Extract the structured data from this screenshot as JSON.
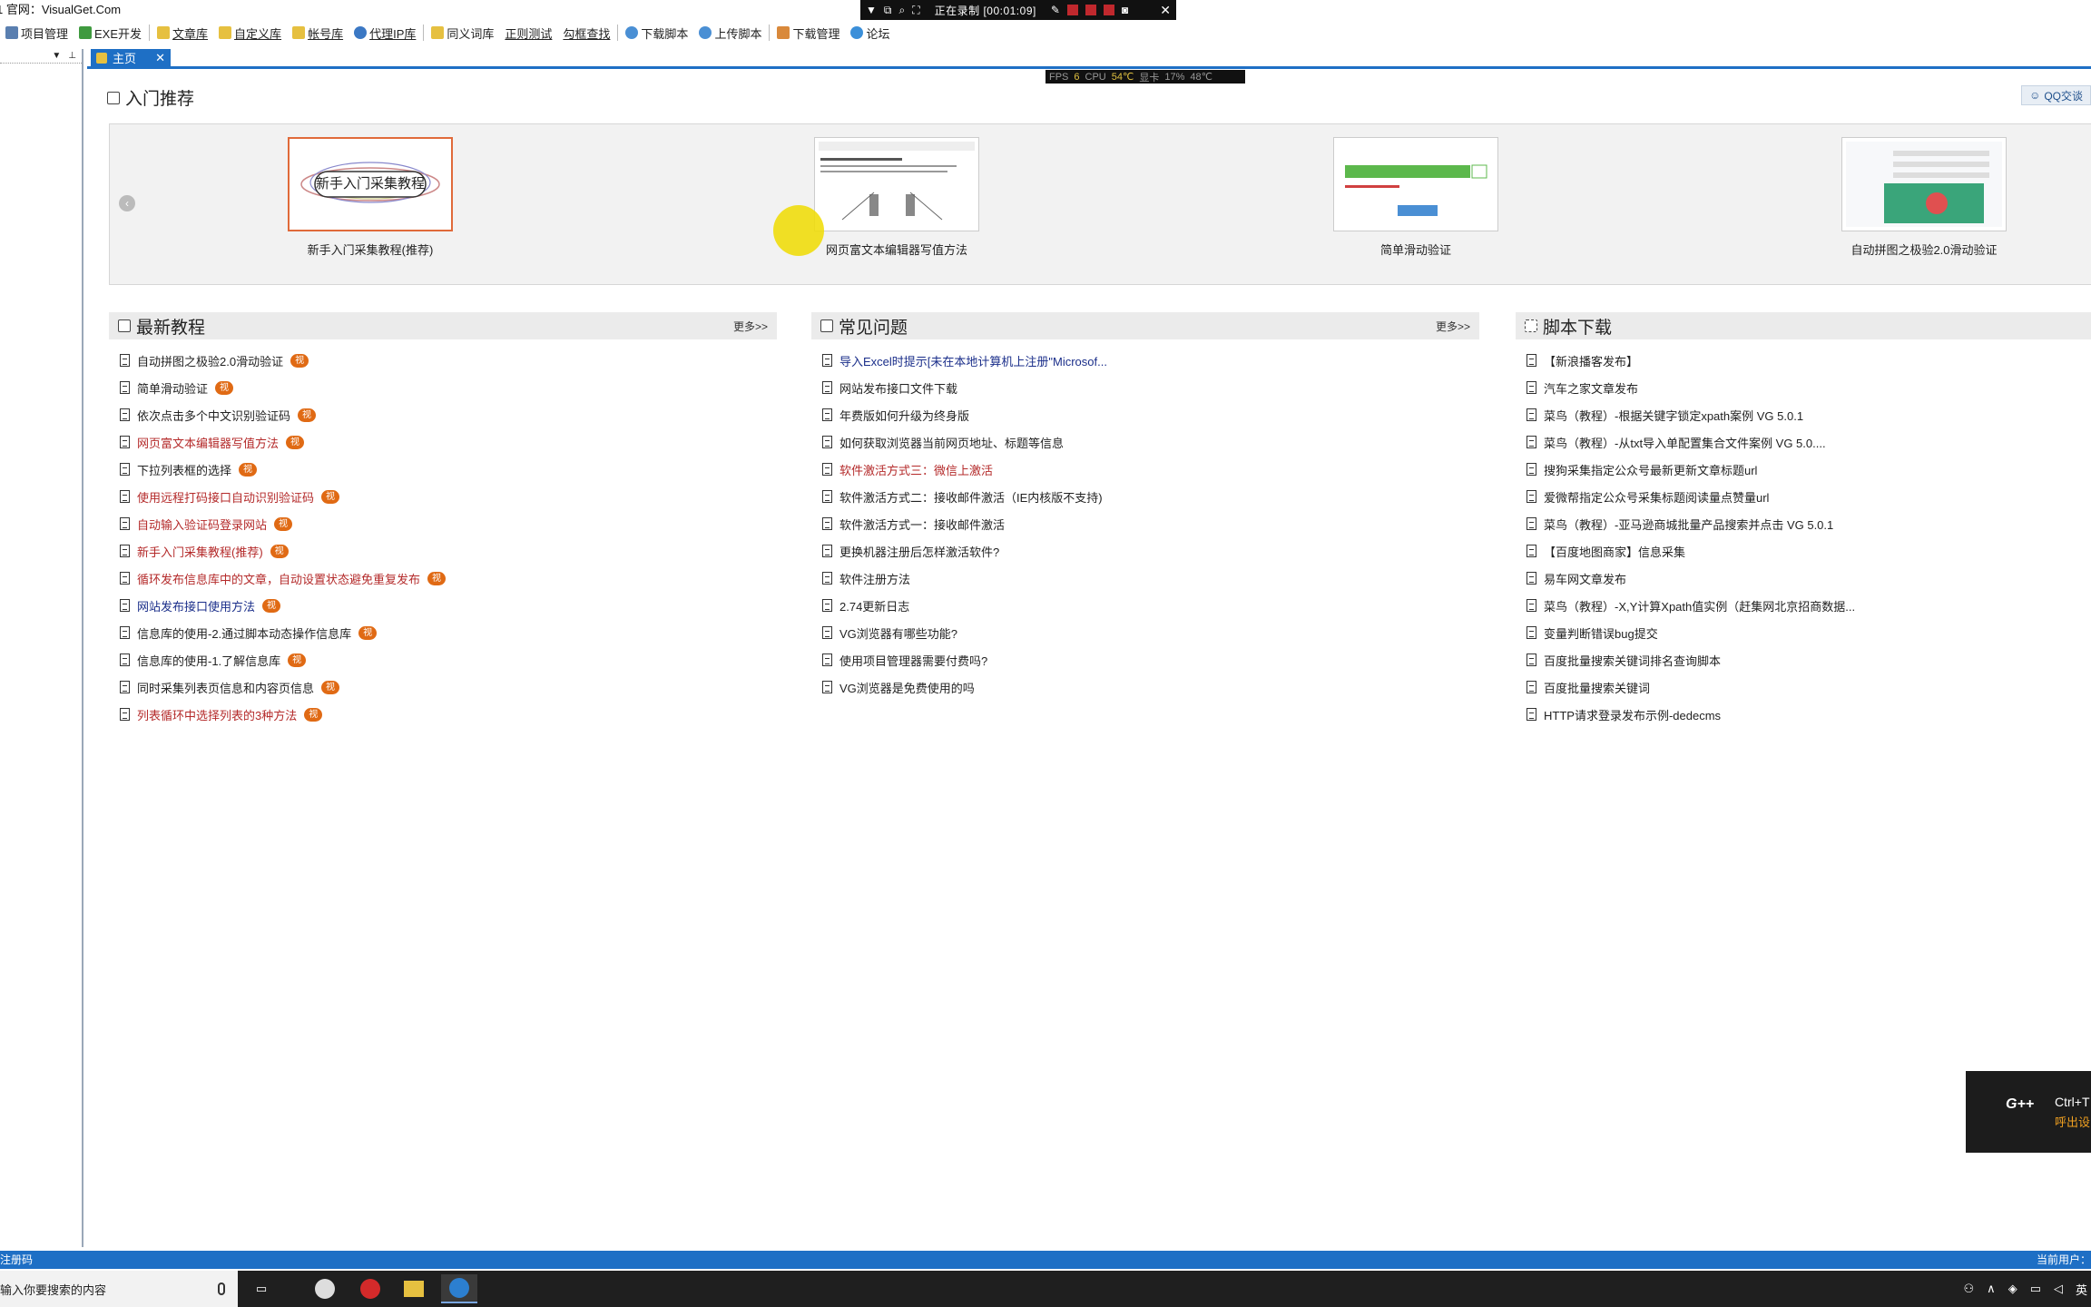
{
  "window": {
    "title": "1  官网：VisualGet.Com"
  },
  "recorder": {
    "status": "正在录制 [00:01:09]"
  },
  "toolbar": {
    "items": [
      {
        "label": "项目管理"
      },
      {
        "label": "EXE开发"
      },
      {
        "label": "文章库"
      },
      {
        "label": "自定义库"
      },
      {
        "label": "帐号库"
      },
      {
        "label": "代理IP库"
      },
      {
        "label": "同义词库"
      },
      {
        "label": "正则测试"
      },
      {
        "label": "勾框查找"
      },
      {
        "label": "下载脚本"
      },
      {
        "label": "上传脚本"
      },
      {
        "label": "下载管理"
      },
      {
        "label": "论坛"
      }
    ]
  },
  "tab": {
    "label": "主页"
  },
  "fps": {
    "fps_label": "FPS",
    "fps_value": "6",
    "cpu_label": "CPU",
    "cpu_value": "54℃",
    "gpu_label": "显卡",
    "gpu_usage": "17%",
    "gpu_temp": "48℃"
  },
  "intro": {
    "title": "入门推荐",
    "qq_label": "QQ交谈",
    "cards": [
      {
        "caption": "新手入门采集教程(推荐)",
        "thumb_text": "新手入门采集教程"
      },
      {
        "caption": "网页富文本编辑器写值方法"
      },
      {
        "caption": "简单滑动验证"
      },
      {
        "caption": "自动拼图之极验2.0滑动验证"
      }
    ]
  },
  "tutorials": {
    "title": "最新教程",
    "more": "更多>>",
    "badge": "视",
    "items": [
      {
        "text": "自动拼图之极验2.0滑动验证",
        "color": "normal"
      },
      {
        "text": "简单滑动验证",
        "color": "normal"
      },
      {
        "text": "依次点击多个中文识别验证码",
        "color": "normal"
      },
      {
        "text": "网页富文本编辑器写值方法",
        "color": "red"
      },
      {
        "text": "下拉列表框的选择",
        "color": "normal"
      },
      {
        "text": "使用远程打码接口自动识别验证码",
        "color": "red"
      },
      {
        "text": "自动输入验证码登录网站",
        "color": "red"
      },
      {
        "text": "新手入门采集教程(推荐)",
        "color": "red"
      },
      {
        "text": "循环发布信息库中的文章，自动设置状态避免重复发布",
        "color": "red"
      },
      {
        "text": "网站发布接口使用方法",
        "color": "blue"
      },
      {
        "text": "信息库的使用-2.通过脚本动态操作信息库",
        "color": "normal"
      },
      {
        "text": "信息库的使用-1.了解信息库",
        "color": "normal"
      },
      {
        "text": "同时采集列表页信息和内容页信息",
        "color": "normal"
      },
      {
        "text": "列表循环中选择列表的3种方法",
        "color": "red"
      }
    ]
  },
  "faq": {
    "title": "常见问题",
    "more": "更多>>",
    "items": [
      {
        "text": "导入Excel时提示[未在本地计算机上注册\"Microsof...",
        "color": "blue"
      },
      {
        "text": "网站发布接口文件下载",
        "color": "normal"
      },
      {
        "text": "年费版如何升级为终身版",
        "color": "normal"
      },
      {
        "text": "如何获取浏览器当前网页地址、标题等信息",
        "color": "normal"
      },
      {
        "text": "软件激活方式三：微信上激活",
        "color": "red"
      },
      {
        "text": "软件激活方式二：接收邮件激活（IE内核版不支持)",
        "color": "normal"
      },
      {
        "text": "软件激活方式一：接收邮件激活",
        "color": "normal"
      },
      {
        "text": "更换机器注册后怎样激活软件?",
        "color": "normal"
      },
      {
        "text": "软件注册方法",
        "color": "normal"
      },
      {
        "text": "2.74更新日志",
        "color": "normal"
      },
      {
        "text": "VG浏览器有哪些功能?",
        "color": "normal"
      },
      {
        "text": "使用项目管理器需要付费吗?",
        "color": "normal"
      },
      {
        "text": "VG浏览器是免费使用的吗",
        "color": "normal"
      }
    ]
  },
  "scripts": {
    "title": "脚本下载",
    "items": [
      {
        "text": "【新浪播客发布】",
        "color": "normal"
      },
      {
        "text": "汽车之家文章发布",
        "color": "normal"
      },
      {
        "text": "菜鸟（教程）-根据关键字锁定xpath案例 VG 5.0.1",
        "color": "normal"
      },
      {
        "text": "菜鸟（教程）-从txt导入单配置集合文件案例 VG 5.0....",
        "color": "normal"
      },
      {
        "text": "搜狗采集指定公众号最新更新文章标题url",
        "color": "normal"
      },
      {
        "text": "爱微帮指定公众号采集标题阅读量点赞量url",
        "color": "normal"
      },
      {
        "text": "菜鸟（教程）-亚马逊商城批量产品搜索并点击 VG 5.0.1",
        "color": "normal"
      },
      {
        "text": "【百度地图商家】信息采集",
        "color": "normal"
      },
      {
        "text": "易车网文章发布",
        "color": "normal"
      },
      {
        "text": "菜鸟（教程）-X,Y计算Xpath值实例（赶集网北京招商数据...",
        "color": "normal"
      },
      {
        "text": "变量判断错误bug提交",
        "color": "normal"
      },
      {
        "text": "百度批量搜索关键词排名查询脚本",
        "color": "normal"
      },
      {
        "text": "百度批量搜索关键词",
        "color": "normal"
      },
      {
        "text": "HTTP请求登录发布示例-dedecms",
        "color": "normal"
      }
    ]
  },
  "adwidget": {
    "logo": "G++",
    "shortcut": "Ctrl+T",
    "hint": "呼出设"
  },
  "statusbar": {
    "left": "注册码",
    "right": "当前用户："
  },
  "taskbar": {
    "search_placeholder": "输入你要搜索的内容",
    "lang": "英"
  }
}
